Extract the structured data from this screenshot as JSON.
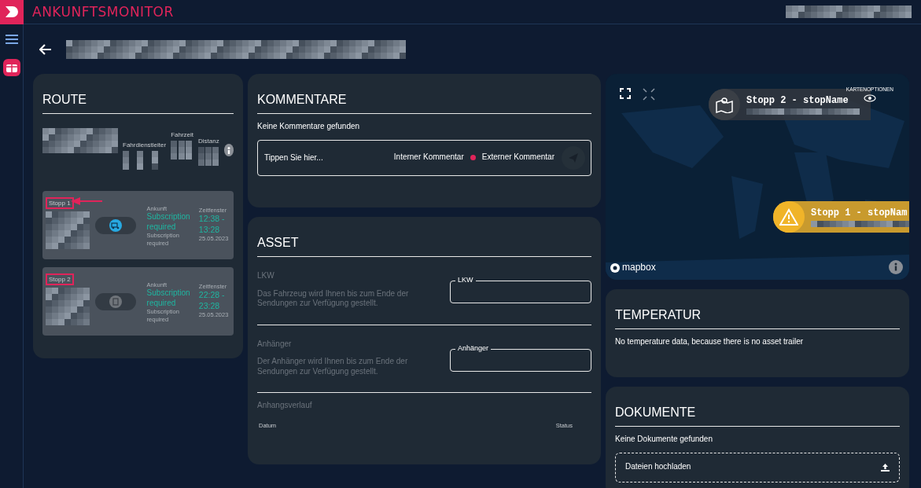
{
  "app": {
    "title": "ANKUNFTSMONITOR"
  },
  "route": {
    "title": "ROUTE",
    "summary_labels": [
      {
        "kind": "driver",
        "text": "Fahrdienstleiter"
      },
      {
        "kind": "time",
        "text": "Fahrzeit"
      },
      {
        "kind": "distance",
        "text": "Distanz"
      }
    ],
    "stops": [
      {
        "label": "Stopp 1",
        "arrow": true,
        "kind": "active",
        "arrival_label": "Ankunft",
        "arrival_status": "Subscription required",
        "arrival_note": "Subscription required",
        "window_label": "Zeitfenster",
        "window_time": "12:38 - 13:28",
        "date": "25.05.2023"
      },
      {
        "label": "Stopp 2",
        "arrow": false,
        "kind": "inactive",
        "arrival_label": "Ankunft",
        "arrival_status": "Subscription required",
        "arrival_note": "Subscription required",
        "window_label": "Zeitfenster",
        "window_time": "22:28 - 23:28",
        "date": "25.05.2023"
      }
    ]
  },
  "comments": {
    "title": "KOMMENTARE",
    "empty": "Keine Kommentare gefunden",
    "placeholder": "Tippen Sie hier...",
    "internal": "Interner Kommentar",
    "external": "Externer Kommentar"
  },
  "asset": {
    "title": "ASSET",
    "sections": [
      {
        "heading": "LKW",
        "description": "Das Fahrzeug wird Ihnen bis zum Ende der Sendungen zur Verfügung gestellt.",
        "field_label": "LKW"
      },
      {
        "heading": "Anhänger",
        "description": "Der Anhänger wird Ihnen bis zum Ende der Sendungen zur Verfügung gestellt.",
        "field_label": "Anhänger"
      }
    ],
    "history": {
      "heading": "Anhangsverlauf",
      "columns": [
        "Datum",
        "Status"
      ]
    }
  },
  "map": {
    "options_label": "KARTENOPTIONEN",
    "markers": [
      {
        "kind": "info",
        "label": "Stopp 2 - stopName"
      },
      {
        "kind": "warning",
        "label": "Stopp 1 - stopNam"
      }
    ],
    "attribution": "mapbox"
  },
  "temperature": {
    "title": "TEMPERATUR",
    "message": "No temperature data, because there is no asset trailer"
  },
  "documents": {
    "title": "DOKUMENTE",
    "empty": "Keine Dokumente gefunden",
    "upload": "Dateien hochladen"
  }
}
